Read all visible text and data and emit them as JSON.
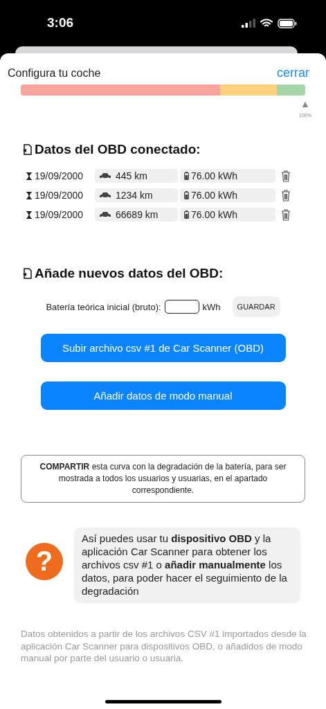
{
  "status_bar": {
    "time": "3:06"
  },
  "header": {
    "title": "Configura tu coche",
    "close": "cerrar"
  },
  "degradation_bar": {
    "segments": [
      {
        "color": "#f8a39c"
      },
      {
        "color": "#fed27f"
      },
      {
        "color": "#a6d5a7"
      }
    ],
    "marker": {
      "glyph": "▲",
      "label": "100%"
    }
  },
  "connected_section": {
    "title": "Datos del OBD conectado:",
    "rows": [
      {
        "date": "19/09/2000",
        "distance": "445 km",
        "energy": "76.00 kWh"
      },
      {
        "date": "19/09/2000",
        "distance": "1234 km",
        "energy": "76.00 kWh"
      },
      {
        "date": "19/09/2000",
        "distance": "66689 km",
        "energy": "76.00 kWh"
      }
    ]
  },
  "add_section": {
    "title": "Añade nuevos datos del OBD:",
    "battery_label": "Batería teórica inicial (bruto):",
    "unit": "kWh",
    "save": "GUARDAR",
    "buttons": [
      "Subir archivo csv #1 de Car Scanner (OBD)",
      "Añadir datos de modo manual"
    ]
  },
  "share": "**COMPARTIR** esta curva con la degradación de la batería, para ser mostrada a todos los usuarios y usuarias, en el apartado correspondiente.",
  "help": {
    "glyph": "?",
    "text": "Así puedes usar tu **dispositivo OBD** y la aplicación Car Scanner para obtener los archivos csv #1 o **añadir manualmente** los datos, para poder hacer el seguimiento de la degradación"
  },
  "footer": "Datos obtenidos a partir de los archivos CSV #1 importados desde la aplicación Car Scanner para dispositivos OBD, o añadidos de modo manual por parte del usuario o usuaria."
}
